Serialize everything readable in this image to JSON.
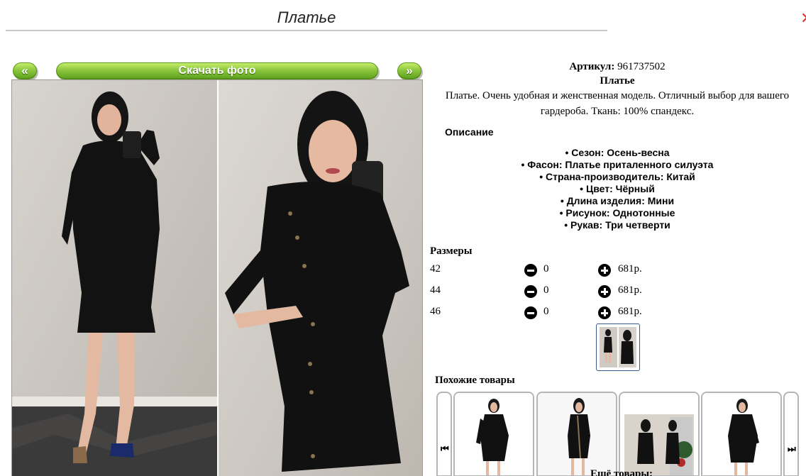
{
  "header": {
    "title": "Платье",
    "close_icon": "close-x-icon",
    "close_color": "#e53030"
  },
  "photo_nav": {
    "prev_label": "«",
    "download_label": "Скачать фото",
    "next_label": "»",
    "button_color": "#8cc63e"
  },
  "product": {
    "article_label": "Артикул:",
    "article_value": "961737502",
    "name": "Платье",
    "description": "Платье. Очень удобная и женственная модель. Отличный выбор для вашего гардероба. Ткань: 100% спандекс."
  },
  "specs": {
    "label": "Описание",
    "items": [
      "• Сезон: Осень-весна",
      "• Фасон: Платье приталенного силуэта",
      "• Страна-производитель: Китай",
      "• Цвет: Чёрный",
      "• Длина изделия: Мини",
      "• Рисунок: Однотонные",
      "• Рукав: Три четверти"
    ]
  },
  "sizes": {
    "label": "Размеры",
    "rows": [
      {
        "size": "42",
        "qty": "0",
        "price": "681р."
      },
      {
        "size": "44",
        "qty": "0",
        "price": "681р."
      },
      {
        "size": "46",
        "qty": "0",
        "price": "681р."
      }
    ]
  },
  "similar": {
    "label": "Похожие товары",
    "prev_icon": "⏮",
    "next_icon": "⏭"
  },
  "more": {
    "label": "Ещё товары:"
  }
}
